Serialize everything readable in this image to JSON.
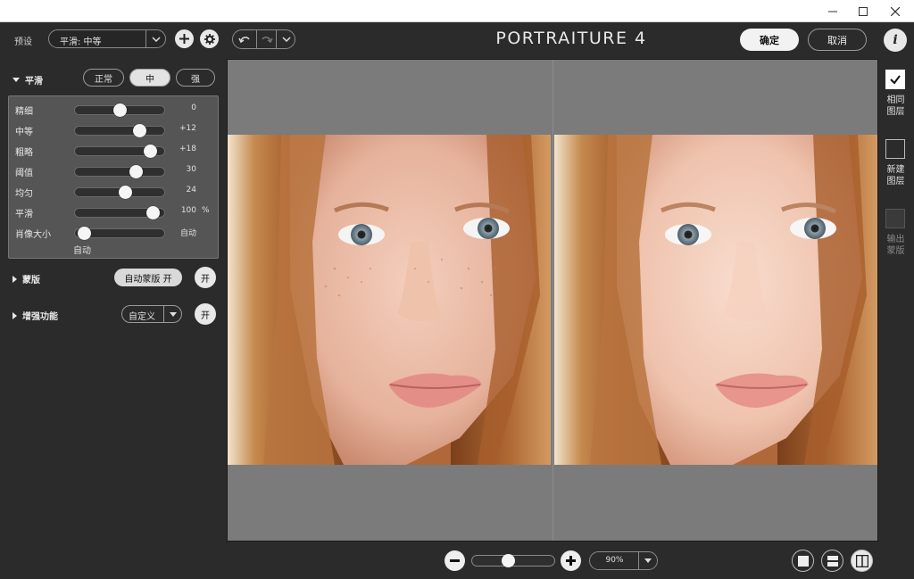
{
  "window": {
    "title": "",
    "controls": [
      "minimize-icon",
      "maximize-icon",
      "close-icon"
    ]
  },
  "toolbar": {
    "preset_label": "预设",
    "preset_value": "平滑: 中等",
    "app_title": "PORTRAITURE 4",
    "ok_label": "确定",
    "cancel_label": "取消",
    "info_label": "i"
  },
  "smoothing": {
    "title": "平滑",
    "strength_options": [
      "正常",
      "中",
      "强"
    ],
    "selected_strength": "中",
    "sliders": [
      {
        "label": "精细",
        "value": "0",
        "unit": "",
        "position": 0.5
      },
      {
        "label": "中等",
        "value": "+12",
        "unit": "",
        "position": 0.76
      },
      {
        "label": "粗略",
        "value": "+18",
        "unit": "",
        "position": 0.9
      },
      {
        "label": "阈值",
        "value": "30",
        "unit": "",
        "position": 0.72
      },
      {
        "label": "均匀",
        "value": "24",
        "unit": "",
        "position": 0.58
      },
      {
        "label": "平滑",
        "value": "100",
        "unit": "%",
        "position": 0.94
      },
      {
        "label": "肖像大小",
        "value": "自动",
        "unit": "",
        "position": 0.04
      }
    ],
    "portrait_size_sublabel": "自动"
  },
  "mask": {
    "title": "蒙版",
    "auto_mask_label": "自动蒙版 开",
    "toggle_label": "开"
  },
  "enhancements": {
    "title": "增强功能",
    "select_value": "自定义",
    "toggle_label": "开"
  },
  "output": {
    "options": [
      {
        "label": "相同\n图层",
        "checked": true,
        "enabled": true
      },
      {
        "label": "新建\n图层",
        "checked": false,
        "enabled": true
      },
      {
        "label": "输出\n蒙版",
        "checked": false,
        "enabled": false
      }
    ]
  },
  "zoom": {
    "value": "90%",
    "level": 0.43
  },
  "view_modes": [
    "single-view-icon",
    "split-horizontal-icon",
    "split-vertical-icon"
  ],
  "selected_view": "split-vertical-icon",
  "colors": {
    "panel_bg": "#2b2b2b",
    "preview_bg": "#7b7b7b",
    "slider_box_bg": "#555555"
  }
}
